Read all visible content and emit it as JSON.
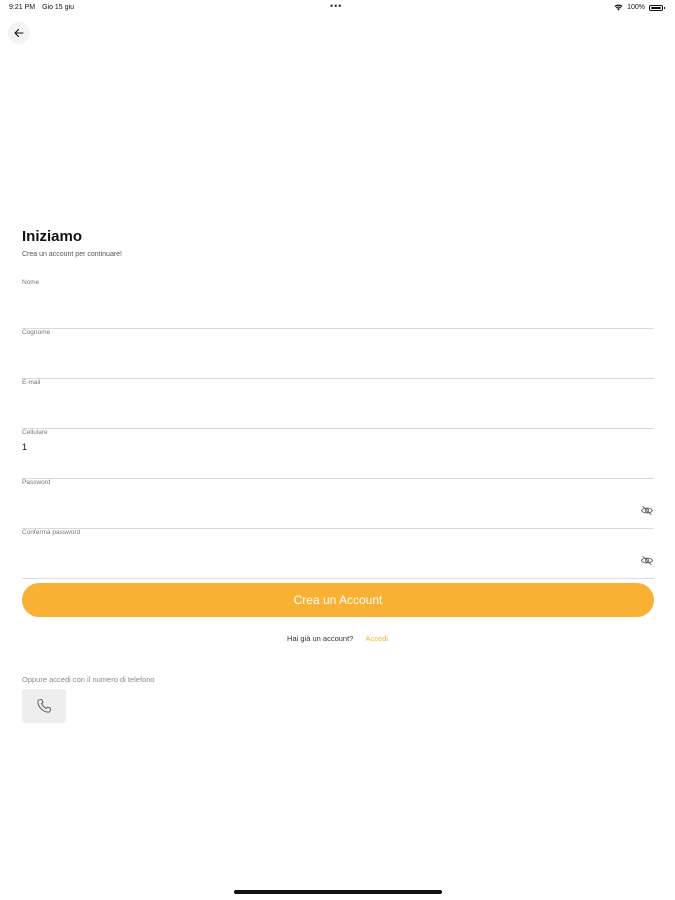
{
  "status_bar": {
    "time": "9:21 PM",
    "date": "Gio 15 giu",
    "center_dots": "•••",
    "battery_percent": "100%",
    "wifi_icon": "wifi-icon",
    "battery_icon": "battery-icon"
  },
  "header": {
    "back_icon": "arrow-left-icon",
    "title": "Iniziamo",
    "subtitle": "Crea un account per continuare!"
  },
  "form": {
    "fields": [
      {
        "label": "Nome",
        "value": "",
        "type": "text"
      },
      {
        "label": "Cognome",
        "value": "",
        "type": "text"
      },
      {
        "label": "E-mail",
        "value": "",
        "type": "email"
      },
      {
        "label": "Cellulare",
        "value": "1",
        "type": "tel"
      },
      {
        "label": "Password",
        "value": "",
        "type": "password",
        "icon": "eye-off-icon"
      },
      {
        "label": "Conferma password",
        "value": "",
        "type": "password",
        "icon": "eye-off-icon"
      }
    ],
    "submit_label": "Crea un Account"
  },
  "login": {
    "question": "Hai già un account?",
    "link": "Accedi"
  },
  "alternative": {
    "text": "Oppure accedi con il numero di telefono",
    "phone_icon": "phone-icon"
  },
  "colors": {
    "accent": "#f8b134",
    "divider": "#d9d9d9"
  }
}
